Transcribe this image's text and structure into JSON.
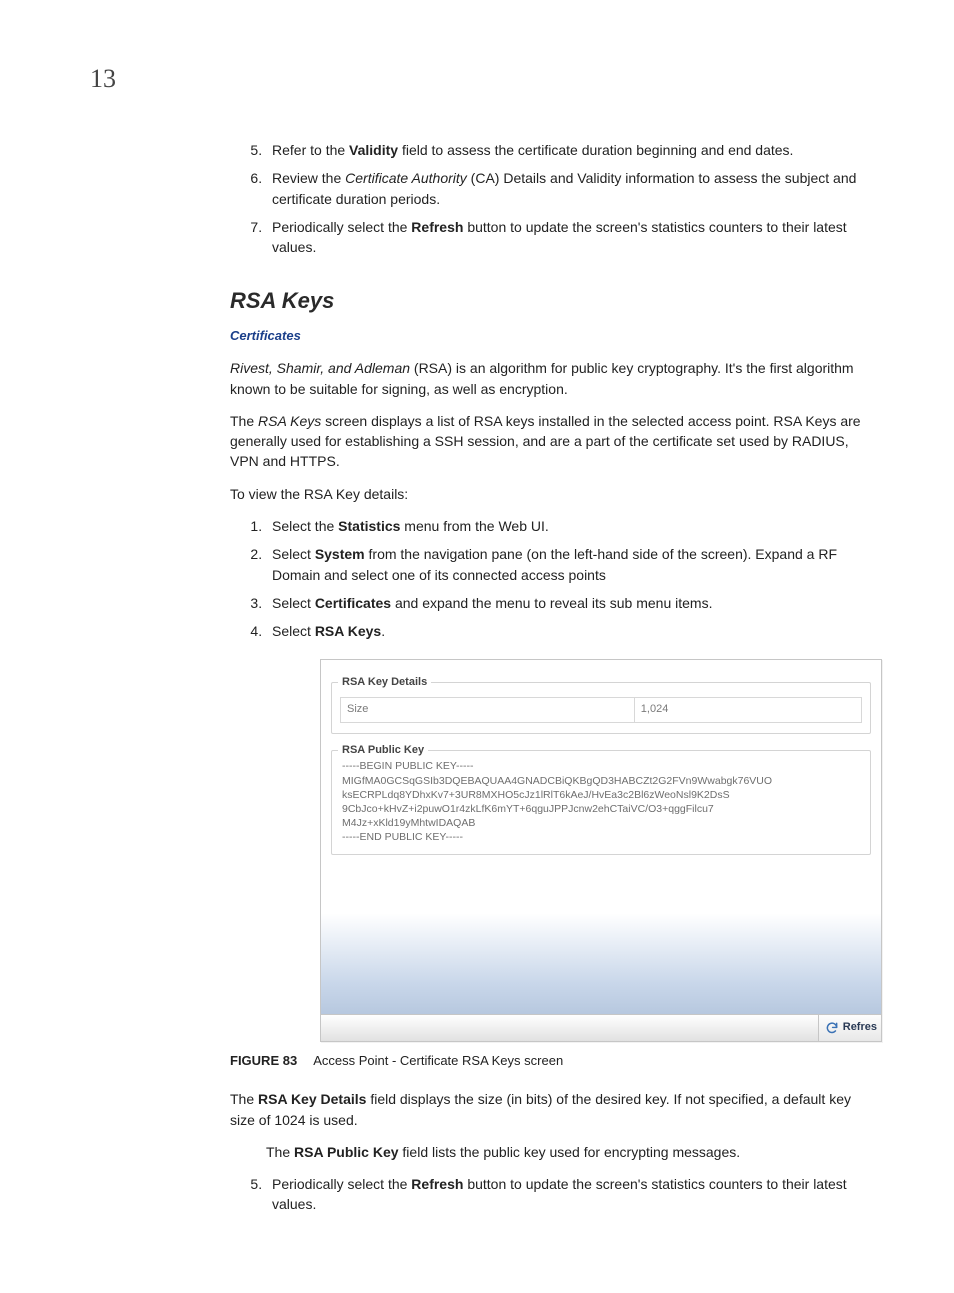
{
  "pageNumber": "13",
  "topList": {
    "start": 5,
    "items": [
      {
        "pre": "Refer to the ",
        "bold": "Validity",
        "post": " field to assess the certificate duration beginning and end dates."
      },
      {
        "pre": "Review the ",
        "ital": "Certificate Authority",
        "post": " (CA) Details and Validity information to assess the subject and certificate duration periods."
      },
      {
        "pre": "Periodically select the ",
        "bold": "Refresh",
        "post": " button to update the screen's statistics counters to their latest values."
      }
    ]
  },
  "sectionTitle": "RSA Keys",
  "breadcrumb": "Certificates",
  "para_intro_pre": "Rivest, Shamir, and Adleman",
  "para_intro_post": " (RSA) is an algorithm for public key cryptography. It's the first algorithm known to be suitable for signing, as well as encryption.",
  "para_screen_pre": "The ",
  "para_screen_ital": "RSA Keys",
  "para_screen_post": " screen displays a list of RSA keys installed in the selected access point. RSA Keys are generally used for establishing a SSH session, and are a part of the certificate set used by RADIUS, VPN and HTTPS.",
  "para_view": "To view the RSA Key details:",
  "stepsList": {
    "start": 1,
    "items": [
      {
        "pre": "Select the ",
        "bold": "Statistics",
        "post": " menu from the Web UI."
      },
      {
        "pre": "Select ",
        "bold": "System",
        "post": " from the navigation pane (on the left-hand side of the screen). Expand a RF Domain and select one of its connected access points"
      },
      {
        "pre": "Select ",
        "bold": "Certificates",
        "post": " and expand the menu to reveal its sub menu items."
      },
      {
        "pre": "Select ",
        "bold": "RSA Keys",
        "post": "."
      }
    ]
  },
  "sshot": {
    "group1Title": "RSA Key Details",
    "sizeLabel": "Size",
    "sizeValue": "1,024",
    "group2Title": "RSA Public Key",
    "keyLines": [
      "-----BEGIN PUBLIC KEY-----",
      "MIGfMA0GCSqGSIb3DQEBAQUAA4GNADCBiQKBgQD3HABCZt2G2FVn9Wwabgk76VUO",
      "ksECRPLdq8YDhxKv7+3UR8MXHO5cJz1lRlT6kAeJ/HvEa3c2Bl6zWeoNsl9K2DsS",
      "9CbJco+kHvZ+i2puwO1r4zkLfK6mYT+6qguJPPJcnw2ehCTaiVC/O3+qggFilcu7",
      "M4Jz+xKld19yMhtwIDAQAB",
      "-----END PUBLIC KEY-----"
    ],
    "refreshLabel": "Refres"
  },
  "figure": {
    "label": "FIGURE 83",
    "caption": "Access Point - Certificate RSA Keys screen"
  },
  "para_details_pre": "The ",
  "para_details_bold": "RSA Key Details",
  "para_details_post": " field displays the size (in bits) of the desired key. If not specified, a default key size of 1024 is used.",
  "para_pubkey_pre": "The ",
  "para_pubkey_bold": "RSA Public Key",
  "para_pubkey_post": " field lists the public key used for encrypting messages.",
  "bottomList": {
    "start": 5,
    "items": [
      {
        "pre": "Periodically select the ",
        "bold": "Refresh",
        "post": " button to update the screen's statistics counters to their latest values."
      }
    ]
  }
}
